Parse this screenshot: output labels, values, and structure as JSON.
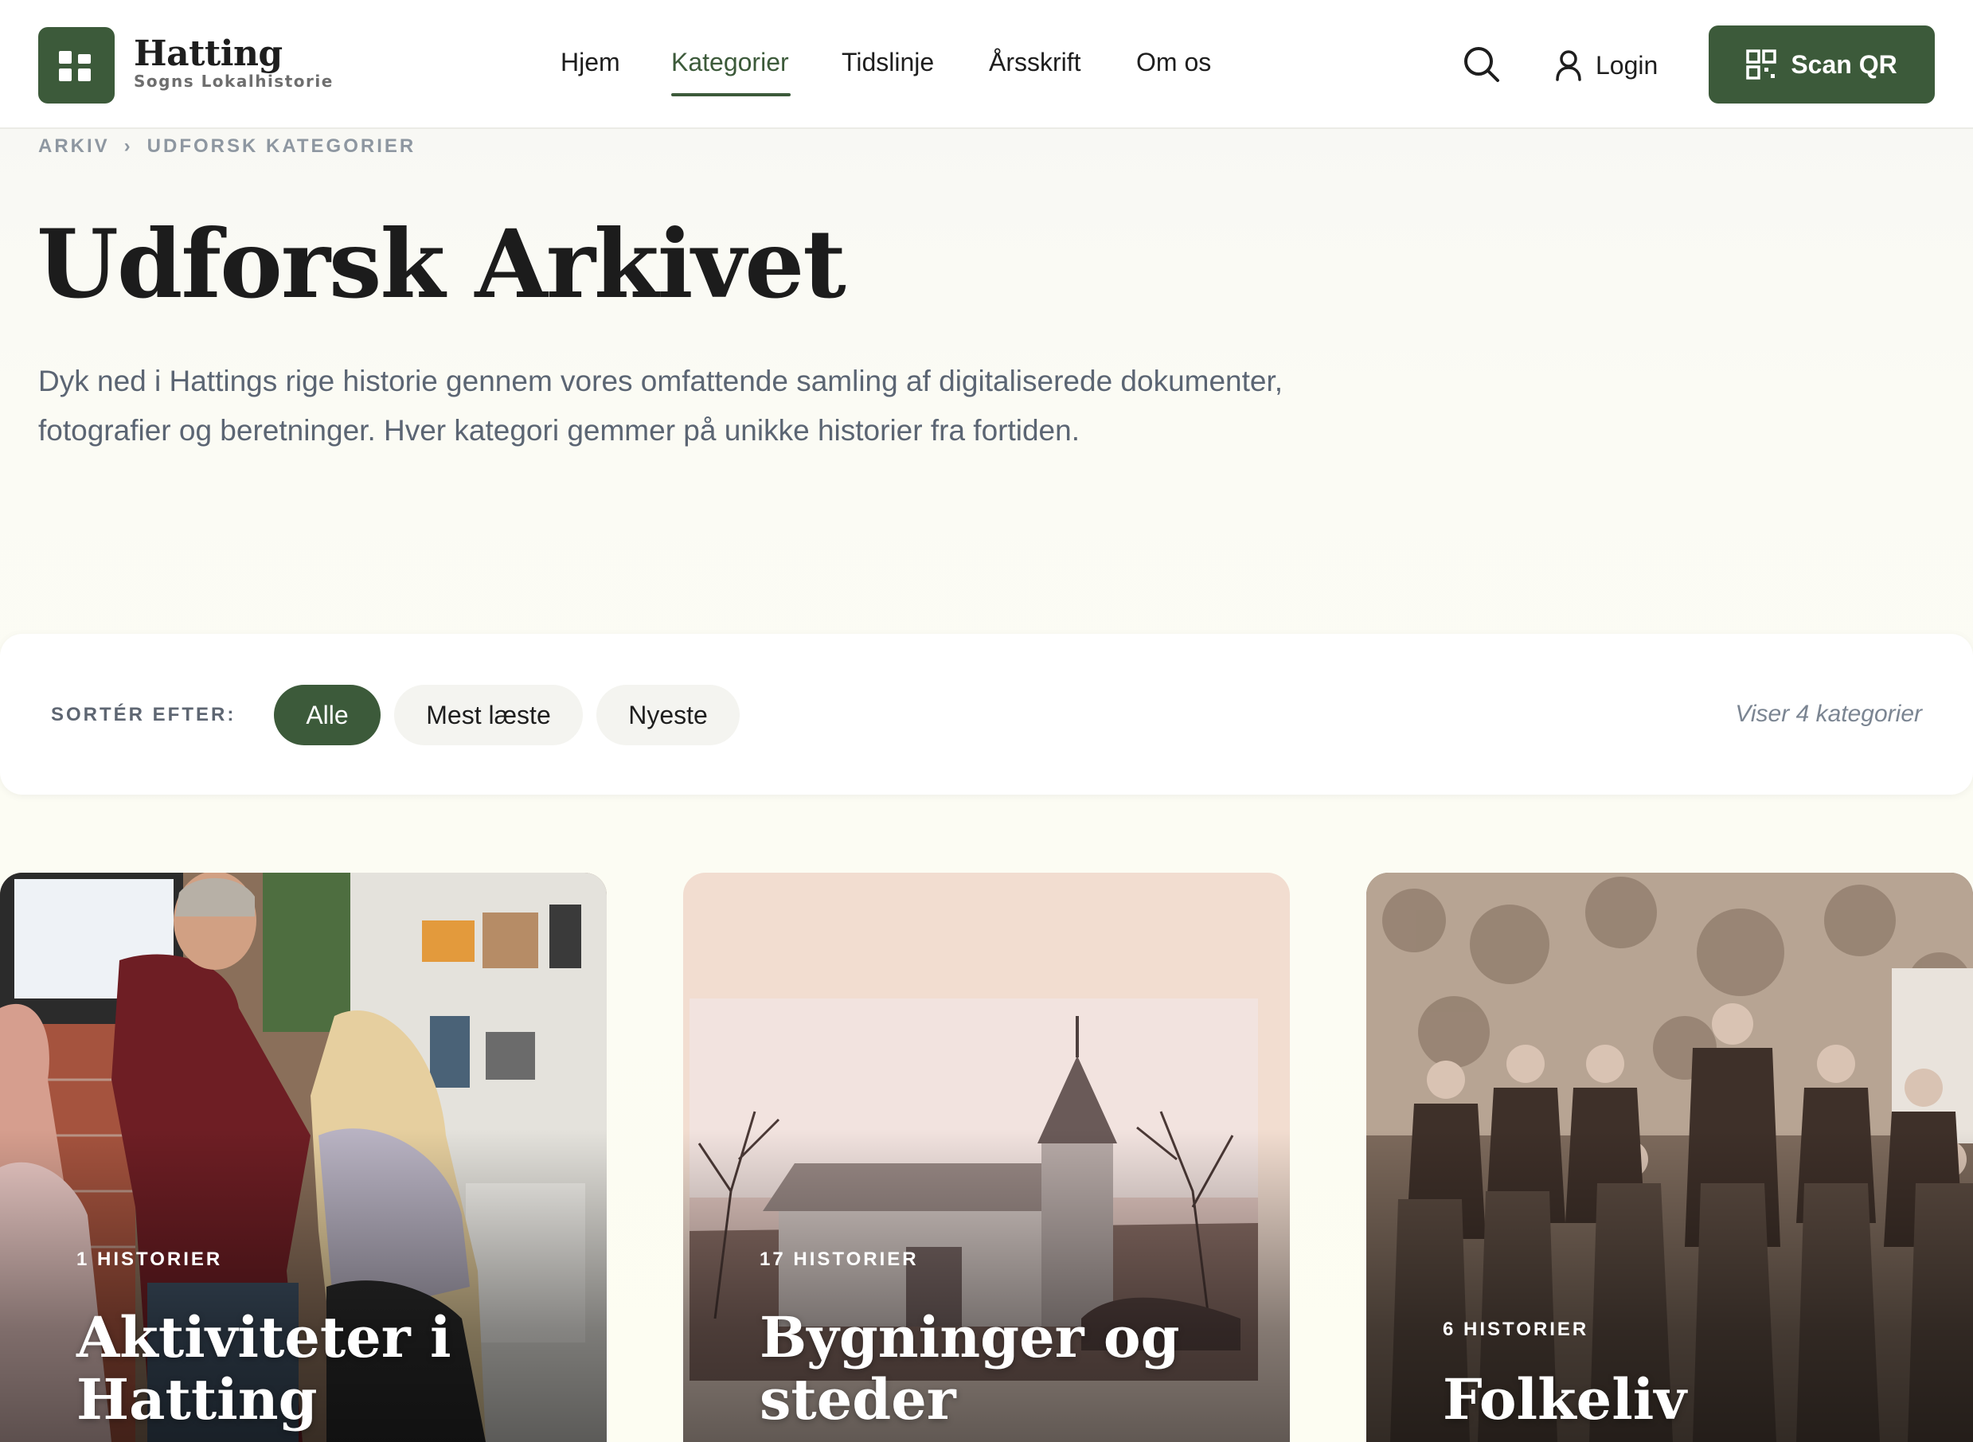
{
  "brand": {
    "name": "Hatting",
    "subtitle": "Sogns Lokalhistorie"
  },
  "nav": {
    "items": [
      {
        "label": "Hjem",
        "active": false
      },
      {
        "label": "Kategorier",
        "active": true
      },
      {
        "label": "Tidslinje",
        "active": false
      },
      {
        "label": "Årsskrift",
        "active": false
      },
      {
        "label": "Om os",
        "active": false
      }
    ]
  },
  "header_actions": {
    "search_icon": "search-icon",
    "login_label": "Login",
    "scan_label": "Scan QR"
  },
  "breadcrumb": {
    "items": [
      "ARKIV",
      "UDFORSK KATEGORIER"
    ],
    "separator": "›"
  },
  "hero": {
    "title": "Udforsk Arkivet",
    "description": "Dyk ned i Hattings rige historie gennem vores omfattende samling af digitaliserede dokumenter, fotografier og beretninger. Hver kategori gemmer på unikke historier fra fortiden."
  },
  "filter": {
    "label": "SORTÉR EFTER:",
    "options": [
      {
        "label": "Alle",
        "active": true
      },
      {
        "label": "Mest læste",
        "active": false
      },
      {
        "label": "Nyeste",
        "active": false
      }
    ],
    "result_text": "Viser 4 kategorier"
  },
  "categories": [
    {
      "count_label": "1 HISTORIER",
      "title": "Aktiviteter i Hatting"
    },
    {
      "count_label": "17 HISTORIER",
      "title": "Bygninger og steder"
    },
    {
      "count_label": "6 HISTORIER",
      "title": "Folkeliv"
    }
  ],
  "colors": {
    "accent": "#3c5a3a",
    "muted_text": "#5b6573",
    "breadcrumb": "#8e97a1"
  }
}
